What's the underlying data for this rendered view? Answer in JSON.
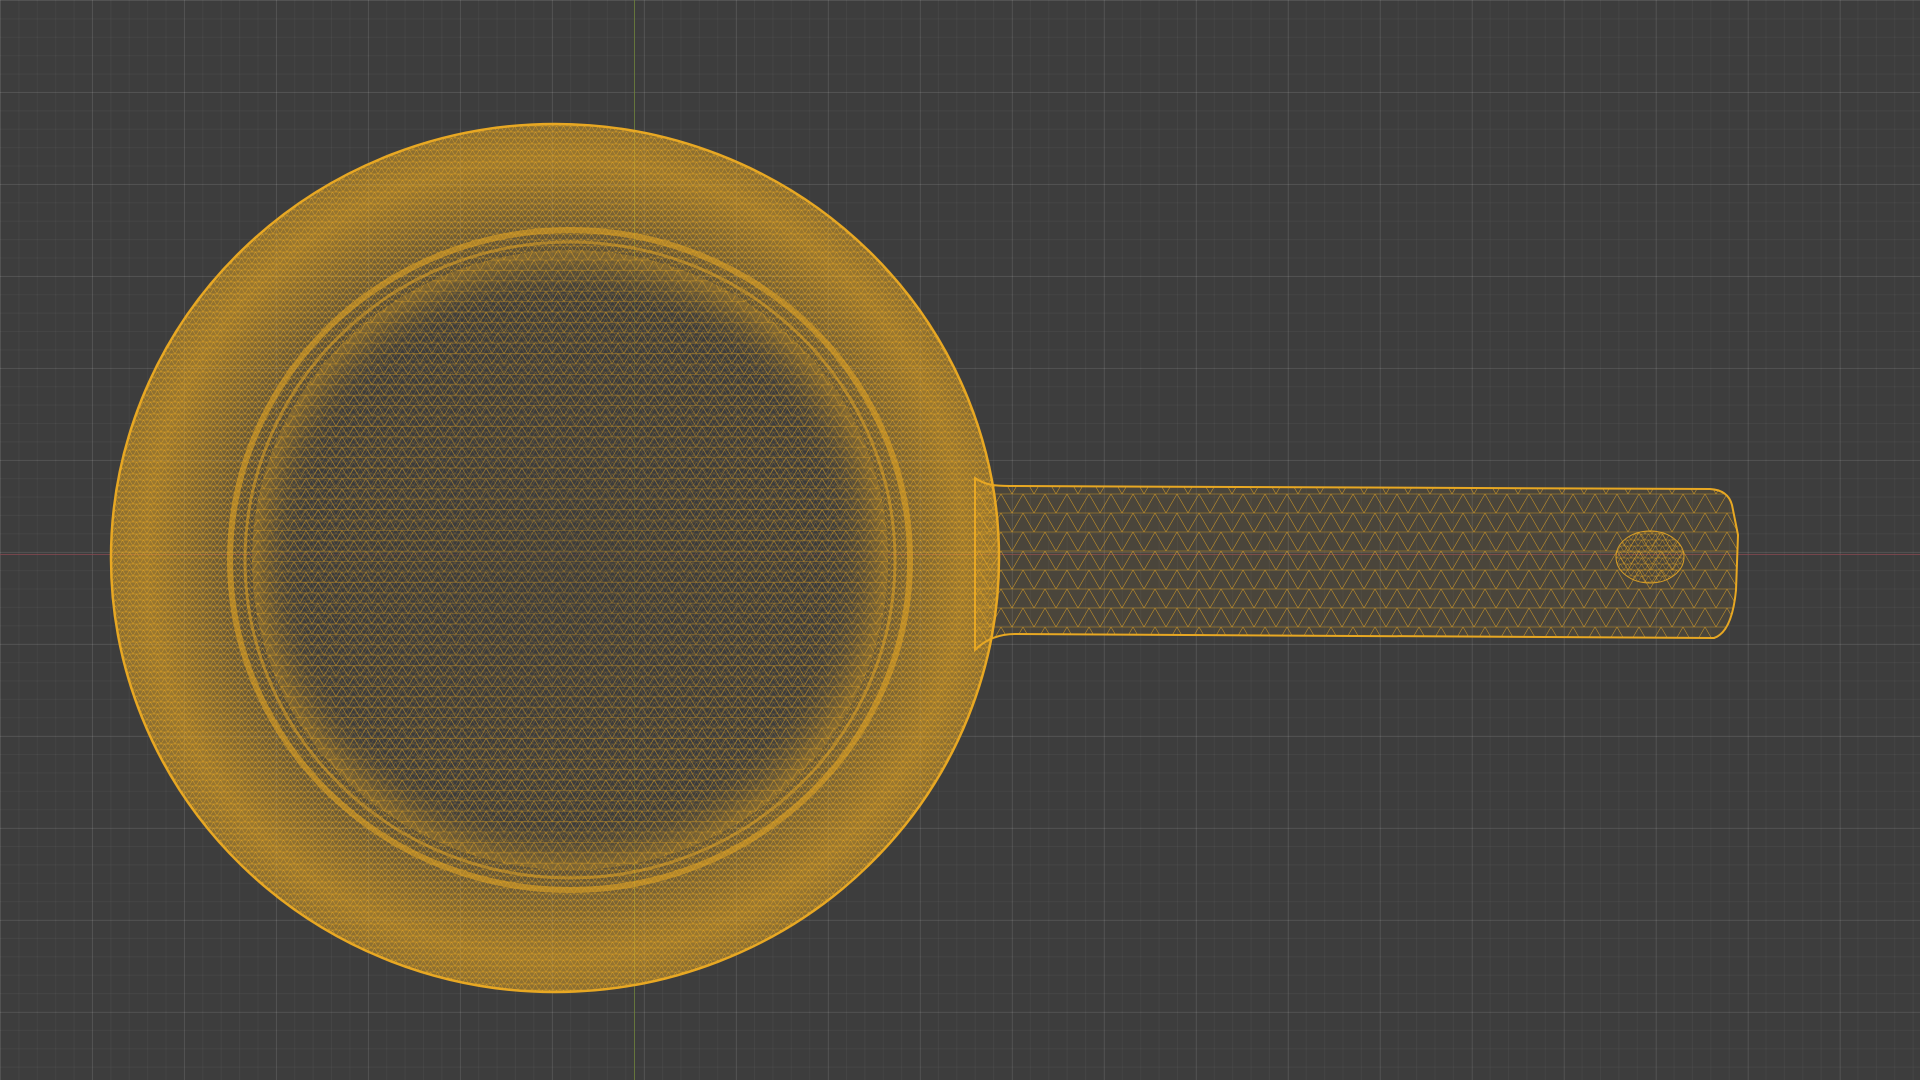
{
  "viewport": {
    "name": "3D Viewport",
    "shading": "wireframe",
    "background_color": "#3d3d3d",
    "grid_color": "#4a4a4a",
    "x_axis_color": "#8a4a52",
    "y_axis_color": "#6c7f3c"
  },
  "object": {
    "kind": "frying-pan",
    "selected": true,
    "wire_color": "#e8a823",
    "parts": [
      "pan-body",
      "pan-inner-base",
      "pan-handle",
      "handle-hole"
    ]
  }
}
